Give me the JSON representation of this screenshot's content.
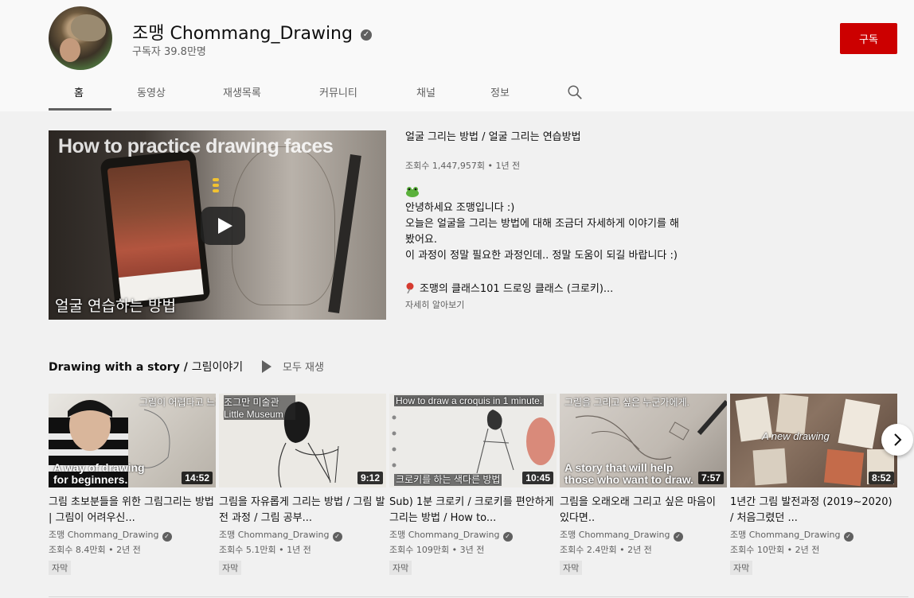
{
  "channel": {
    "name": "조맹 Chommang_Drawing",
    "subscribers": "구독자 39.8만명",
    "subscribe_label": "구독",
    "verified_glyph": "✓"
  },
  "tabs": [
    {
      "label": "홈",
      "active": true
    },
    {
      "label": "동영상"
    },
    {
      "label": "재생목록"
    },
    {
      "label": "커뮤니티"
    },
    {
      "label": "채널"
    },
    {
      "label": "정보"
    }
  ],
  "featured": {
    "thumb_title": "How to practice drawing faces",
    "thumb_caption": "얼굴 연습하는 방법",
    "title": "얼굴 그리는 방법 / 얼굴 그리는 연습방법",
    "meta": "조회수 1,447,957회 • 1년 전",
    "description": "안녕하세요 조맹입니다 :)\n오늘은 얼굴을 그리는 방법에 대해 조금더 자세하게 이야기를 해\n봤어요.\n이 과정이 정말 필요한 과정인데.. 정말 도움이 되길 바랍니다 :)",
    "pin_line": "조맹의 클래스101 드로잉 클래스 (크로키)...",
    "more_label": "자세히 알아보기"
  },
  "section": {
    "title_en": "Drawing with a story / ",
    "title_ko": "그림이야기",
    "play_all": "모두 재생"
  },
  "videos": [
    {
      "ov_top": "그림이 어렵다고 느끼는 왕초보 분들께",
      "ov_bottom": "A way of drawing\nfor beginners.",
      "duration": "14:52",
      "title": "그림 초보분들을 위한 그림그리는 방법 | 그림이 어려우신...",
      "channel": "조맹 Chommang_Drawing",
      "meta": "조회수 8.4만회 • 2년 전",
      "badge": "자막"
    },
    {
      "ov_top": "조그만 미술관 Little Museum",
      "ov_bottom": "",
      "duration": "9:12",
      "title": "그림을 자유롭게 그리는 방법 / 그림 발전 과정 / 그림 공부...",
      "channel": "조맹 Chommang_Drawing",
      "meta": "조회수 5.1만회 • 1년 전",
      "badge": "자막"
    },
    {
      "ov_top": "How to draw a croquis in 1 minute.",
      "ov_bottom": "크로키를 하는 색다른 방법",
      "duration": "10:45",
      "title": "Sub) 1분 크로키 / 크로키를 편안하게 그리는 방법 / How to...",
      "channel": "조맹 Chommang_Drawing",
      "meta": "조회수 109만회 • 3년 전",
      "badge": "자막"
    },
    {
      "ov_top": "그림을 그리고 싶은 누군가에게.",
      "ov_bottom": "A story that will help\nthose who want to draw.",
      "duration": "7:57",
      "title": "그림을 오래오래 그리고 싶은 마음이 있다면..",
      "channel": "조맹 Chommang_Drawing",
      "meta": "조회수 2.4만회 • 2년 전",
      "badge": "자막"
    },
    {
      "ov_top": "A new drawing",
      "ov_bottom": "",
      "duration": "8:52",
      "title": "1년간 그림 발전과정 (2019~2020) / 처음그렸던 ...",
      "channel": "조맹 Chommang_Drawing",
      "meta": "조회수 10만회 • 2년 전",
      "badge": "자막"
    }
  ]
}
